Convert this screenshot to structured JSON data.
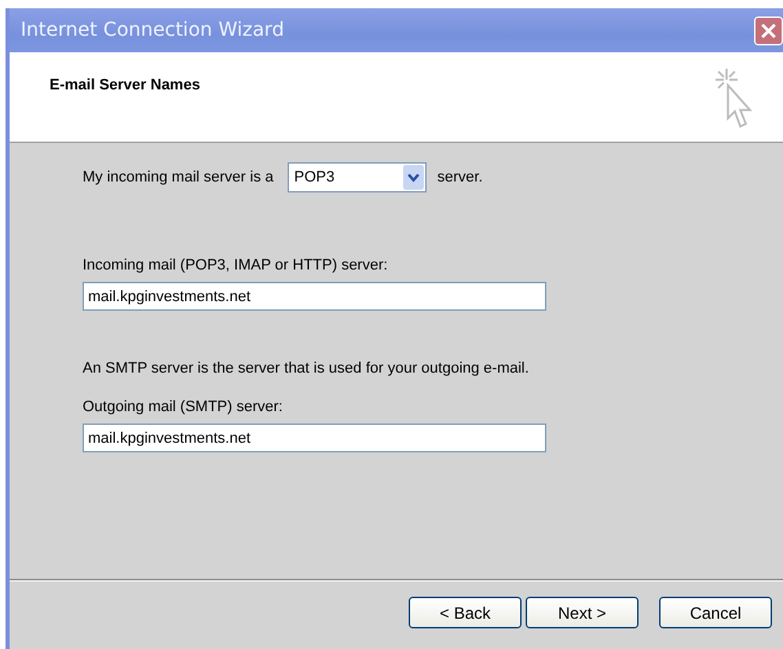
{
  "window": {
    "title": "Internet Connection Wizard"
  },
  "header": {
    "title": "E-mail Server Names"
  },
  "server_type": {
    "label_before": "My incoming mail server is a",
    "value": "POP3",
    "label_after": "server."
  },
  "incoming": {
    "label": "Incoming mail (POP3, IMAP or HTTP) server:",
    "value": "mail.kpginvestments.net"
  },
  "smtp_note": "An SMTP server is the server that is used for your outgoing e-mail.",
  "outgoing": {
    "label": "Outgoing mail (SMTP) server:",
    "value": "mail.kpginvestments.net"
  },
  "buttons": [
    {
      "label": "< Back",
      "kind": "nav"
    },
    {
      "label": "Next >",
      "kind": "nav"
    },
    {
      "label": "Cancel",
      "kind": "cancel"
    }
  ]
}
